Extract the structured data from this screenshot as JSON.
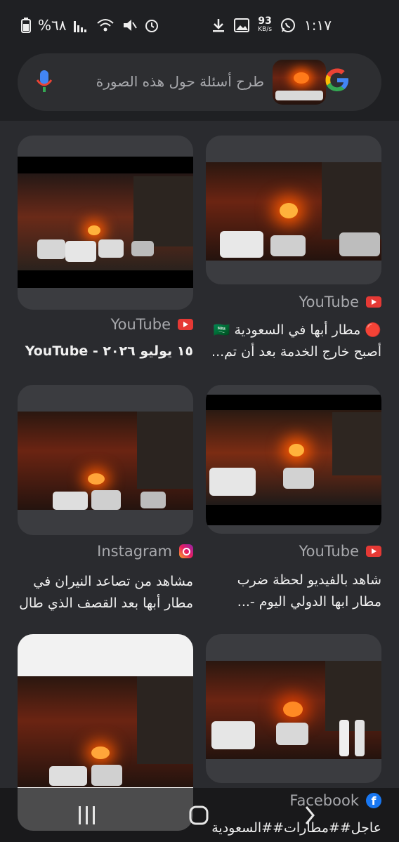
{
  "status_bar": {
    "time": "١:١٧",
    "battery": "%٦٨",
    "network_speed": "93",
    "network_unit": "KB/s"
  },
  "search": {
    "placeholder": "طرح أسئلة حول هذه الصورة",
    "logo": "google-logo",
    "mic_icon": "mic-icon"
  },
  "results": [
    {
      "source": "YouTube",
      "source_icon": "youtube-icon",
      "title_line1": "🔴 مطار أبها في السعودية 🇸🇦",
      "title_line2": "أصبح خارج الخدمة بعد أن تم..."
    },
    {
      "source": "YouTube",
      "source_icon": "youtube-icon",
      "title_line1": "١٥ يوليو ٢٠٢٦ - YouTube"
    },
    {
      "source": "YouTube",
      "source_icon": "youtube-icon",
      "title_line1": "شاهد بالفيديو لحظة ضرب",
      "title_line2": "مطار ابها الدولي اليوم -..."
    },
    {
      "source": "Instagram",
      "source_icon": "instagram-icon",
      "title_line1": "مشاهد من تصاعد النيران في",
      "title_line2": "مطار أبها بعد القصف الذي طال..."
    },
    {
      "source": "Facebook",
      "source_icon": "facebook-icon",
      "title_line1": "عاجل##مطارات##السعودية"
    }
  ],
  "navbar": {
    "recents": "recents-icon",
    "home": "home-icon",
    "back": "back-icon"
  }
}
